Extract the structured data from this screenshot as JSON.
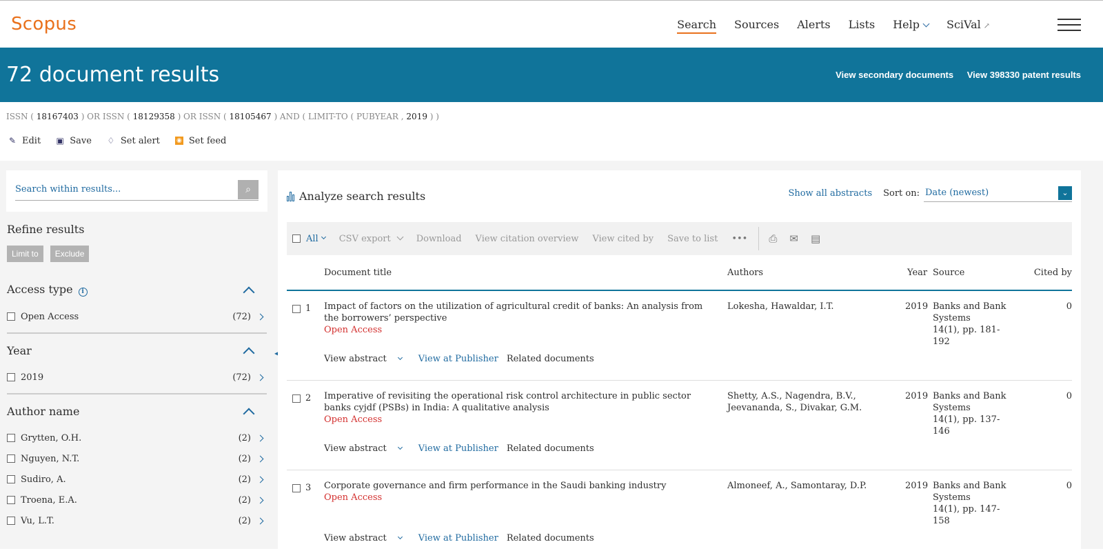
{
  "header": {
    "logo": "Scopus",
    "nav": [
      "Search",
      "Sources",
      "Alerts",
      "Lists",
      "Help",
      "SciVal"
    ],
    "scival_arrow": "↗"
  },
  "banner": {
    "title": "72 document results",
    "secondary_link": "View secondary documents",
    "patent_link": "View 398330 patent results"
  },
  "query": {
    "parts": [
      {
        "t": "ISSN (",
        "b": false
      },
      {
        "t": " 18167403 ",
        "b": true
      },
      {
        "t": ") OR ISSN (",
        "b": false
      },
      {
        "t": " 18129358 ",
        "b": true
      },
      {
        "t": ") OR ISSN (",
        "b": false
      },
      {
        "t": " 18105467 ",
        "b": true
      },
      {
        "t": ") AND ( LIMIT-TO ( PUBYEAR , ",
        "b": false
      },
      {
        "t": " 2019 ",
        "b": true
      },
      {
        "t": ") )",
        "b": false
      }
    ]
  },
  "actions": {
    "edit": "Edit",
    "save": "Save",
    "set_alert": "Set alert",
    "set_feed": "Set feed"
  },
  "sidebar": {
    "search_placeholder": "Search within results...",
    "refine_title": "Refine results",
    "limit_to": "Limit to",
    "exclude": "Exclude",
    "facets": [
      {
        "title": "Access type",
        "info": true,
        "items": [
          {
            "label": "Open Access",
            "count": "(72)"
          }
        ]
      },
      {
        "title": "Year",
        "info": false,
        "items": [
          {
            "label": "2019",
            "count": "(72)"
          }
        ]
      },
      {
        "title": "Author name",
        "info": false,
        "items": [
          {
            "label": "Grytten, O.H.",
            "count": "(2)"
          },
          {
            "label": "Nguyen, N.T.",
            "count": "(2)"
          },
          {
            "label": "Sudiro, A.",
            "count": "(2)"
          },
          {
            "label": "Troena, E.A.",
            "count": "(2)"
          },
          {
            "label": "Vu, L.T.",
            "count": "(2)"
          }
        ]
      }
    ]
  },
  "main": {
    "analyze": "Analyze search results",
    "show_abstracts": "Show all abstracts",
    "sort_label": "Sort on:",
    "sort_value": "Date (newest)",
    "toolbar": {
      "all": "All",
      "csv": "CSV export",
      "download": "Download",
      "citation": "View citation overview",
      "cited_by": "View cited by",
      "save_list": "Save to list",
      "more": "•••"
    },
    "columns": {
      "title": "Document title",
      "authors": "Authors",
      "year": "Year",
      "source": "Source",
      "cited": "Cited by"
    },
    "row_actions": {
      "abstract": "View abstract",
      "publisher": "View at Publisher",
      "related": "Related documents"
    },
    "results": [
      {
        "num": "1",
        "title": "Impact of factors on the utilization of agricultural credit of banks: An analysis from the borrowers’ perspective",
        "oa": "Open Access",
        "authors": "Lokesha, Hawaldar, I.T.",
        "year": "2019",
        "source": "Banks and Bank Systems",
        "pages": "14(1), pp. 181-192",
        "cited": "0"
      },
      {
        "num": "2",
        "title": "Imperative of revisiting the operational risk control architecture in public sector banks cyjdf (PSBs) in India: A qualitative analysis",
        "oa": "Open Access",
        "authors": "Shetty, A.S., Nagendra, B.V., Jeevananda, S., Divakar, G.M.",
        "year": "2019",
        "source": "Banks and Bank Systems",
        "pages": "14(1), pp. 137-146",
        "cited": "0"
      },
      {
        "num": "3",
        "title": "Corporate governance and firm performance in the Saudi banking industry",
        "oa": "Open Access",
        "authors": "Almoneef, A., Samontaray, D.P.",
        "year": "2019",
        "source": "Banks and Bank Systems",
        "pages": "14(1), pp. 147-158",
        "cited": "0"
      }
    ]
  }
}
